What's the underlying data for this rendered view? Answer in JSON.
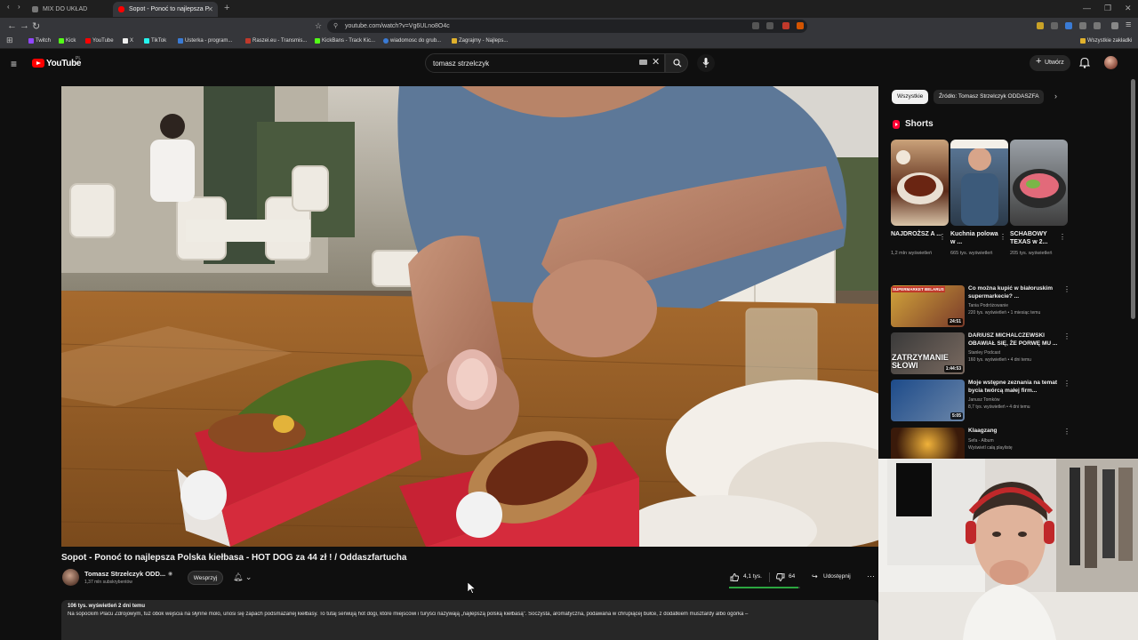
{
  "browser": {
    "tabs": [
      {
        "title": "MIX DO UKŁAD",
        "active": false
      },
      {
        "title": "Sopot - Ponoć to najlepsza P",
        "active": true
      }
    ],
    "url": "youtube.com/watch?v=Vg6ULno8O4c",
    "bookmarks": [
      "Twitch",
      "Kick",
      "YouTube",
      "X",
      "TikTok",
      "Usterka - program...",
      "Raszei.eu - Transmis...",
      "KickBans - Track Kic...",
      "wiadomosc do grub...",
      "Zagrajmy - Najleps..."
    ],
    "all_bookmarks_label": "Wszystkie zakładki"
  },
  "header": {
    "logo_text": "YouTube",
    "country": "PL",
    "search_value": "tomasz strzelczyk",
    "create_label": "Utwórz"
  },
  "video": {
    "title": "Sopot - Ponoć to najlepsza Polska kiełbasa - HOT DOG za 44 zł ! / Oddaszfartucha",
    "channel": "Tomasz Strzelczyk ODD...",
    "subscribers": "1,37 mln subskrybentów",
    "support_label": "Wesprzyj",
    "likes": "4,1 tys.",
    "like_ratio": 0.98,
    "dislikes": "64",
    "share_label": "Udostępnij",
    "meta": "106 tys. wyświetleń  2 dni temu",
    "description": "Na sopockim Placu Zdrojowym, tuż obok wejścia na słynne molo, unosi się zapach podsmażanej kiełbasy. To tutaj serwują hot dogi, które miejscowi i turyści nazywają „najlepszą polską kiełbasą\". Soczysta, aromatyczna, podawana w chrupiącej bułce, z dodatkiem musztardy albo ogórka –"
  },
  "sidebar": {
    "chips": [
      "Wszystkie",
      "Źródło: Tomasz Strzelczyk ODDASZFA"
    ],
    "shorts_title": "Shorts",
    "shorts": [
      {
        "title": "NAJDROŻSZ A ...",
        "views": "1,2 mln wyświetleń"
      },
      {
        "title": "Kuchnia polowa w ...",
        "views": "665 tys. wyświetleń"
      },
      {
        "title": "SCHABOWY TEXAS w 2...",
        "views": "205 tys. wyświetleń"
      }
    ],
    "recommendations": [
      {
        "title": "Co można kupić w białoruskim supermarkecie? ...",
        "channel": "Tania Podróżowanie",
        "meta": "220 tys. wyświetleń • 1 miesiąc temu",
        "duration": "24:51",
        "thumb_text": "SUPERMARKET BELARUS"
      },
      {
        "title": "DARIUSZ MICHALCZEWSKI OBAWIAŁ SIĘ, ŻE PORWĘ MU ...",
        "channel": "Stanley Podcast",
        "meta": "160 tys. wyświetleń • 4 dni temu",
        "duration": "1:44:53",
        "thumb_text": "ZATRZYMANIE SŁOWI"
      },
      {
        "title": "Moje wstępne zeznania na temat bycia twórcą małej firm...",
        "channel": "Janusz Tomków",
        "meta": "8,7 tys. wyświetleń • 4 dni temu",
        "duration": "5:05",
        "thumb_text": ""
      },
      {
        "title": "Klaagzang",
        "channel": "Sefa - Album",
        "meta": "Wyświetl całą playlistę",
        "duration": "",
        "thumb_text": ""
      }
    ]
  },
  "colors": {
    "accent": "#ff0000",
    "background": "#0f0f0f",
    "like_bar": "#2ba640"
  }
}
